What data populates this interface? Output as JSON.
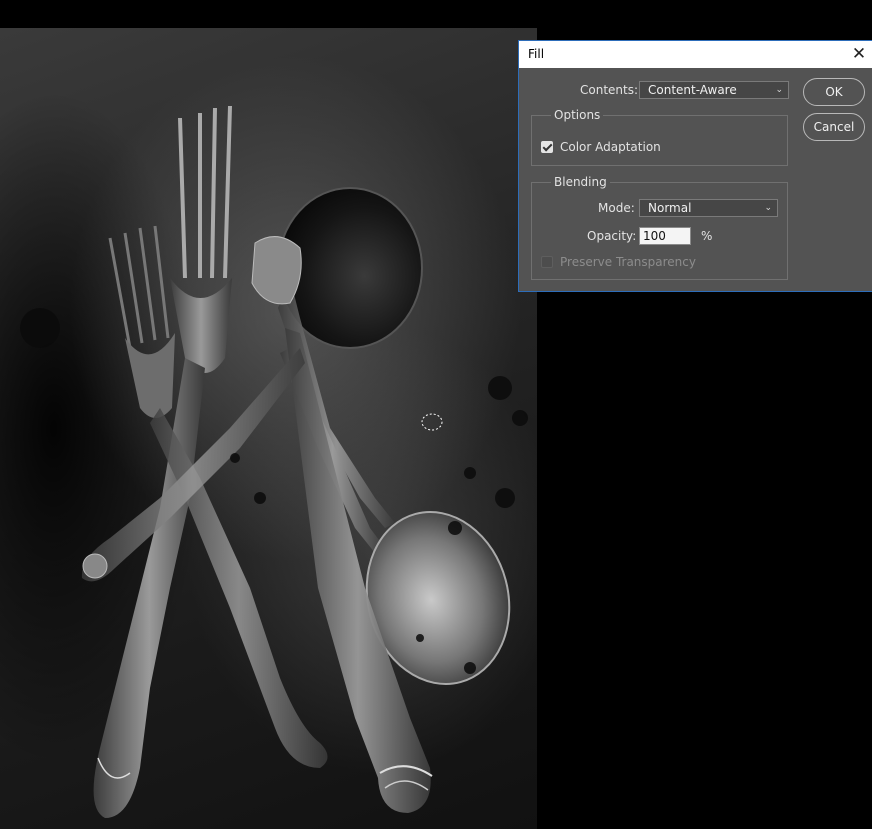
{
  "dialog": {
    "title": "Fill",
    "close_glyph": "✕",
    "contents_label": "Contents:",
    "contents_value": "Content-Aware",
    "ok_label": "OK",
    "cancel_label": "Cancel",
    "options": {
      "group_title": "Options",
      "color_adaptation_label": "Color Adaptation",
      "color_adaptation_checked": true
    },
    "blending": {
      "group_title": "Blending",
      "mode_label": "Mode:",
      "mode_value": "Normal",
      "opacity_label": "Opacity:",
      "opacity_value": "100",
      "opacity_unit": "%",
      "preserve_label": "Preserve Transparency",
      "preserve_checked": false
    }
  },
  "icons": {
    "close": "close-icon",
    "dropdown": "chevron-down-icon",
    "check": "checkmark-icon",
    "lasso_cursor": "lasso-selection-icon"
  },
  "colors": {
    "dialog_bg": "#535353",
    "accent_border": "#2d6dba",
    "canvas_bg": "#000000"
  }
}
